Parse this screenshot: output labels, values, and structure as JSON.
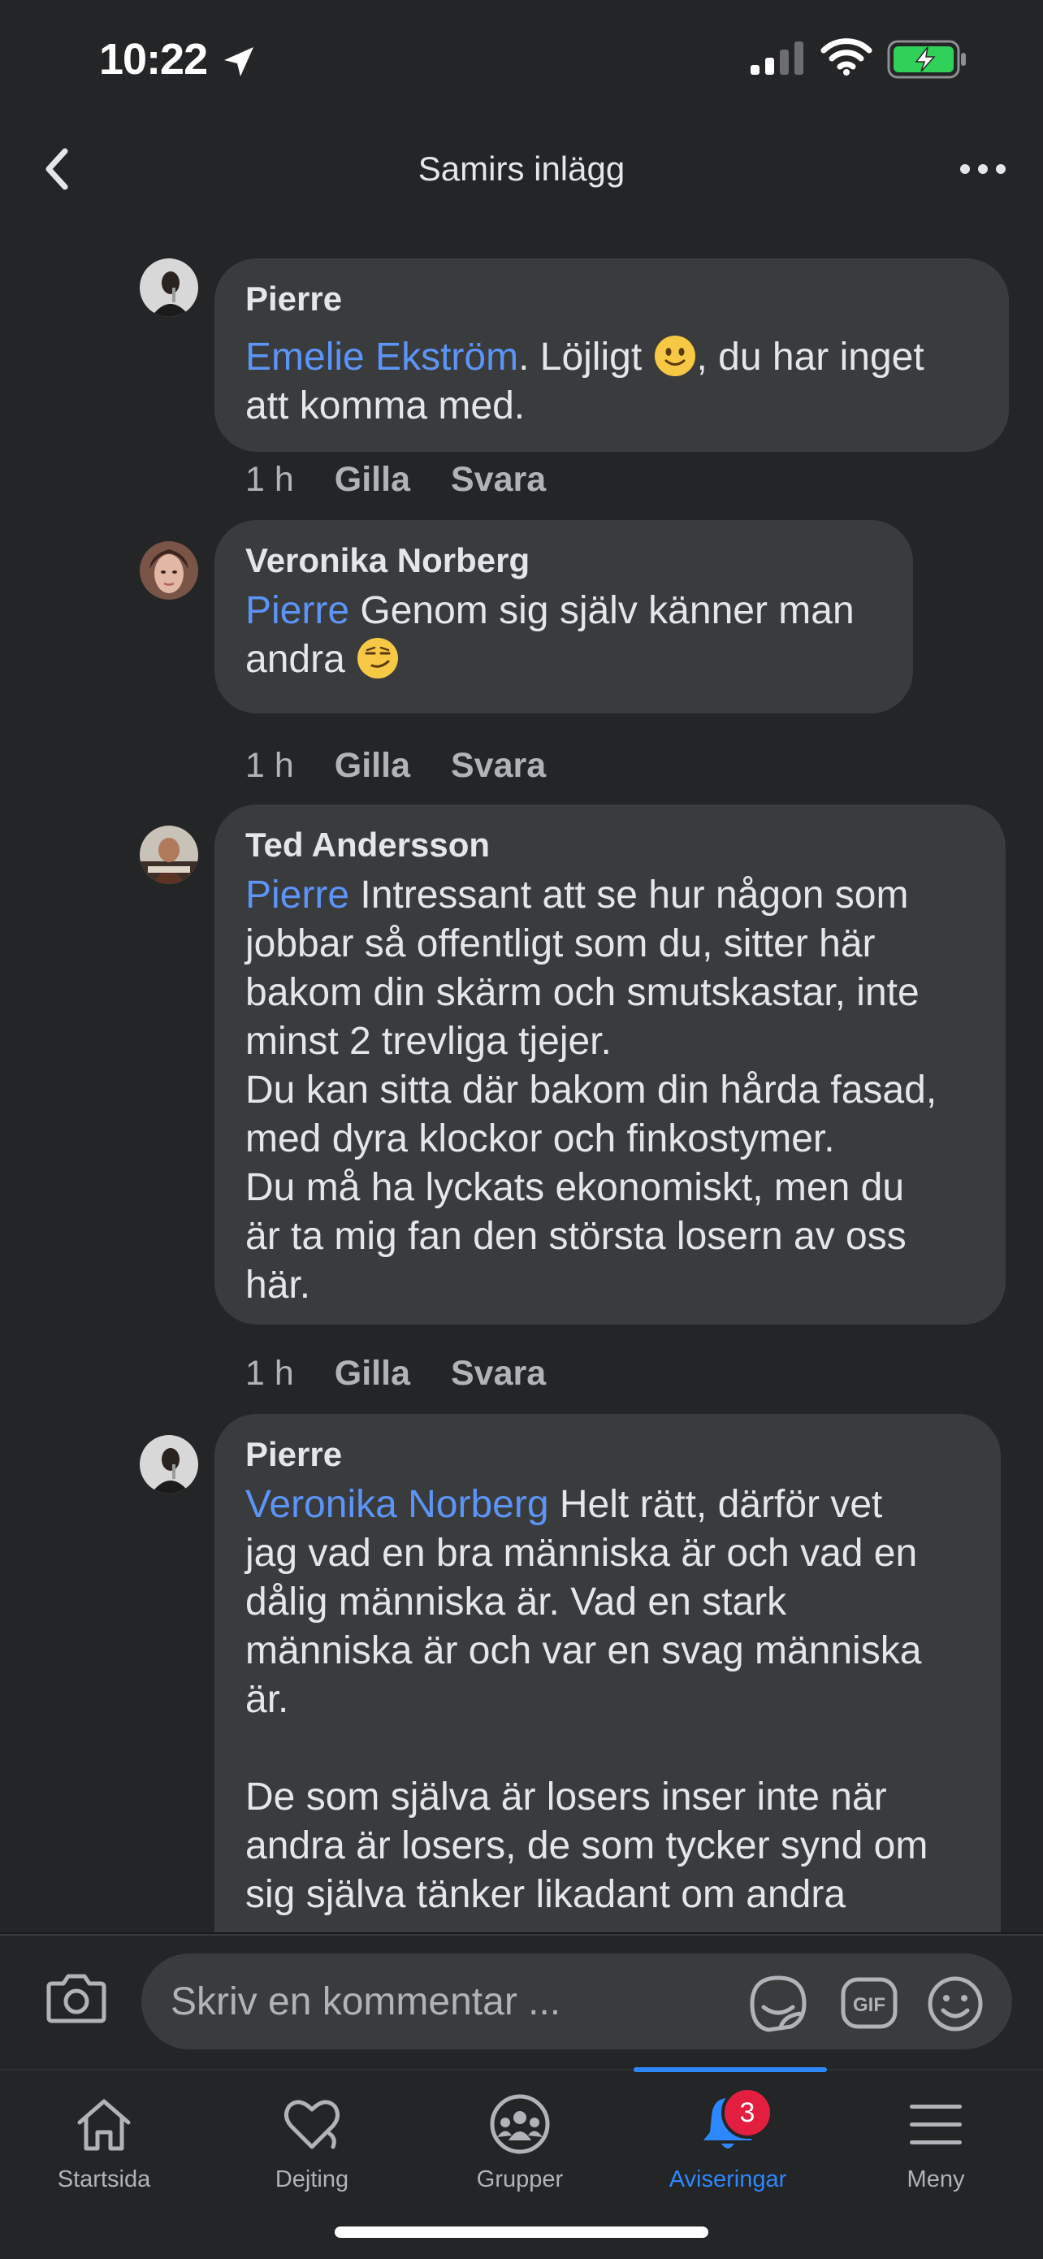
{
  "status_bar": {
    "time": "10:22"
  },
  "header": {
    "title": "Samirs inlägg"
  },
  "comments": [
    {
      "author": "Pierre",
      "mention": "Emelie Ekström",
      "text_before_emoji": ".  Löjligt ",
      "text_after_emoji": ", du har inget\natt komma med.",
      "emoji": "slightly-smiling-face",
      "time": "1 h",
      "like": "Gilla",
      "reply": "Svara"
    },
    {
      "author": "Veronika Norberg",
      "mention": "Pierre",
      "text_before_emoji": " Genom sig själv känner man\nandra ",
      "text_after_emoji": "",
      "emoji": "smirking-face",
      "time": "1 h",
      "like": "Gilla",
      "reply": "Svara"
    },
    {
      "author": "Ted Andersson",
      "mention": "Pierre",
      "text": " Intressant att se hur någon som\njobbar så offentligt som du, sitter här\nbakom din skärm och smutskastar, inte\nminst 2 trevliga tjejer.\nDu kan sitta där bakom din hårda fasad,\nmed dyra klockor och finkostymer.\nDu må ha lyckats ekonomiskt, men du\när ta mig fan den största losern av oss\nhär.",
      "time": "1 h",
      "like": "Gilla",
      "reply": "Svara"
    },
    {
      "author": "Pierre",
      "mention": "Veronika Norberg",
      "text": " Helt rätt, därför vet\njag vad en bra människa är och vad en\ndålig människa är. Vad en stark\nmänniska är och var en svag människa\när.\n\nDe som själva är losers inser inte när\nandra är losers, de som tycker synd om\nsig själva tänker likadant om andra"
    }
  ],
  "composer": {
    "placeholder": "Skriv en kommentar ..."
  },
  "tabs": [
    {
      "label": "Startsida",
      "icon": "home-icon"
    },
    {
      "label": "Dejting",
      "icon": "heart-icon"
    },
    {
      "label": "Grupper",
      "icon": "groups-icon"
    },
    {
      "label": "Aviseringar",
      "icon": "bell-icon",
      "badge": "3",
      "active": true
    },
    {
      "label": "Meny",
      "icon": "menu-icon"
    }
  ],
  "colors": {
    "background": "#242526",
    "bubble": "#3a3b3c",
    "mention": "#5c94f7",
    "active_tab": "#2d88ff",
    "badge": "#e41e3f"
  }
}
